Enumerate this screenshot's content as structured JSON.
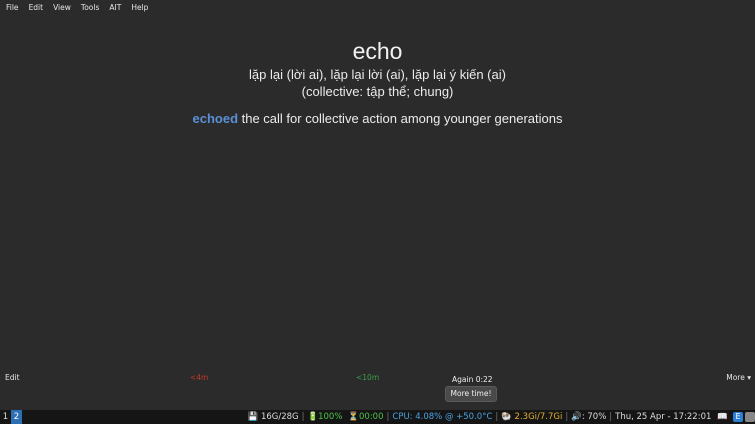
{
  "menu": [
    "File",
    "Edit",
    "View",
    "Tools",
    "AIT",
    "Help"
  ],
  "card": {
    "word": "echo",
    "meaning_line1": "lặp lại (lời ai), lặp lại lời (ai), lặp lại ý kiến (ai)",
    "meaning_line2": "(collective: tập thể; chung)",
    "example_highlight": "echoed",
    "example_rest": " the call for collective action among younger generations"
  },
  "answer_bar": {
    "edit_label": "Edit",
    "ease1_label": "<4m",
    "ease2_label": "<10m",
    "again_label": "Again 0:22",
    "more_label": "More ▾",
    "more_time_label": "More time!"
  },
  "taskbar": {
    "workspaces": [
      "1",
      "2"
    ],
    "active_workspace": "2",
    "disk": "💾 16G/28G",
    "battery": "🔋100%",
    "timer": "⏳00:00",
    "cpu": "CPU:  4.08% @ +50.0°C",
    "mem": "🐏 2.3Gi/7.7Gi",
    "volume": "🔊: 70%",
    "datetime": "Thu, 25 Apr - 17:22:01",
    "tray_book_icon": "book-icon",
    "tray_e_label": "E"
  },
  "colors": {
    "background": "#2b2b2b",
    "highlight": "#5b8fd6",
    "ease1": "#c0392b",
    "ease2": "#3aa04a",
    "taskbar": "#151515",
    "workspace_active": "#2d6fb5"
  }
}
